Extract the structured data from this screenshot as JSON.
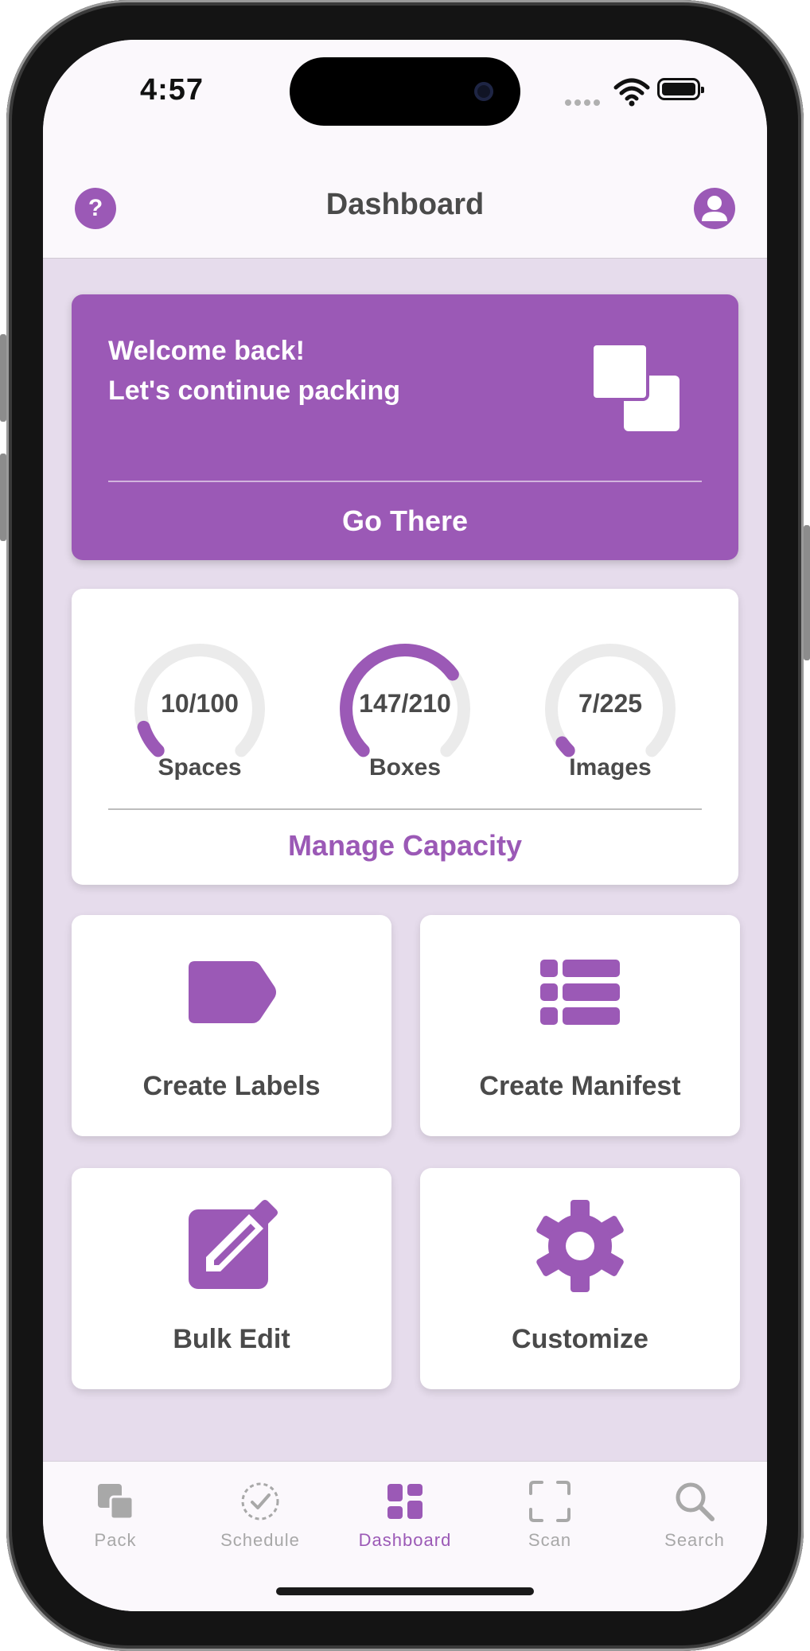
{
  "status": {
    "time": "4:57"
  },
  "header": {
    "title": "Dashboard",
    "help_glyph": "?"
  },
  "welcome": {
    "line1": "Welcome back!",
    "line2": "Let's continue packing",
    "action": "Go There"
  },
  "capacity": {
    "gauges": [
      {
        "label": "Spaces",
        "text": "10/100",
        "used": 10,
        "total": 100
      },
      {
        "label": "Boxes",
        "text": "147/210",
        "used": 147,
        "total": 210
      },
      {
        "label": "Images",
        "text": "7/225",
        "used": 7,
        "total": 225
      }
    ],
    "action": "Manage Capacity"
  },
  "tiles": [
    {
      "label": "Create Labels",
      "icon": "tag-icon"
    },
    {
      "label": "Create Manifest",
      "icon": "list-icon"
    },
    {
      "label": "Bulk Edit",
      "icon": "edit-icon"
    },
    {
      "label": "Customize",
      "icon": "gear-icon"
    }
  ],
  "tabs": [
    {
      "label": "Pack",
      "icon": "pack-icon"
    },
    {
      "label": "Schedule",
      "icon": "schedule-icon"
    },
    {
      "label": "Dashboard",
      "icon": "dashboard-icon",
      "active": true
    },
    {
      "label": "Scan",
      "icon": "scan-icon"
    },
    {
      "label": "Search",
      "icon": "search-icon"
    }
  ],
  "colors": {
    "accent": "#9b59b6",
    "text": "#4a4a4a",
    "gauge_track": "#ebebeb",
    "tab_inactive": "#a8a8a8",
    "background": "#e6dcec"
  }
}
